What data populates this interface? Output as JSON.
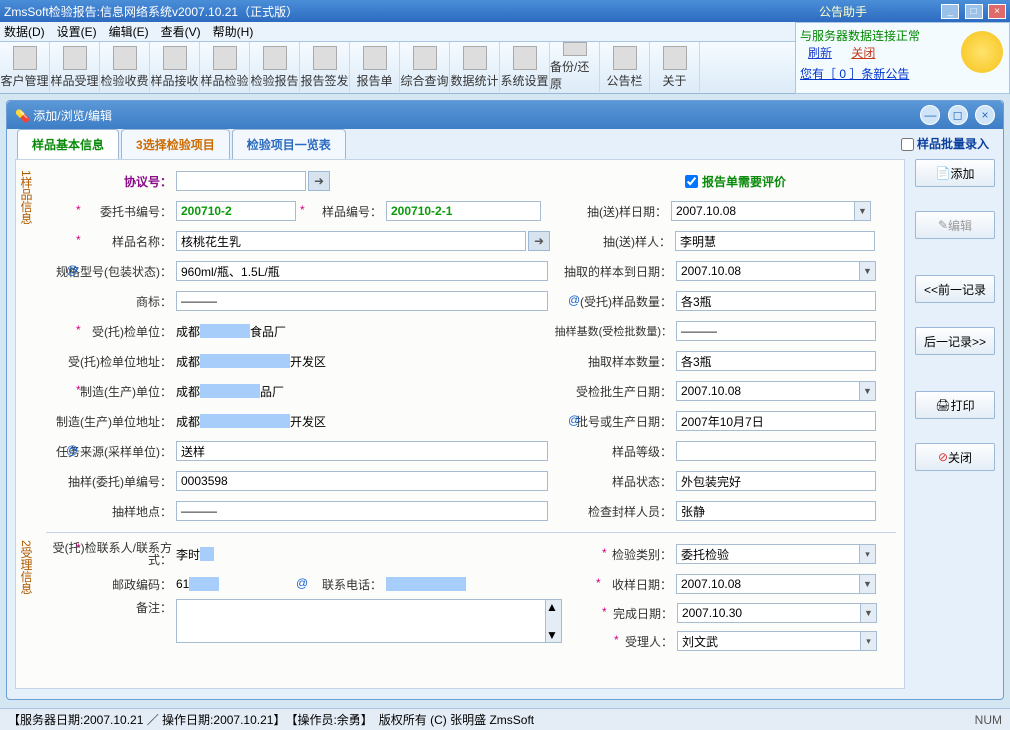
{
  "outer_title": "ZmsSoft检验报告:信息网络系统v2007.10.21（正式版）",
  "assistant": {
    "title": "公告助手",
    "status": "与服务器数据连接正常",
    "refresh": "刷新",
    "close": "关闭",
    "news": "您有［ 0 ］条新公告"
  },
  "menus": [
    "数据(D)",
    "设置(E)",
    "编辑(E)",
    "查看(V)",
    "帮助(H)"
  ],
  "tools": [
    "客户管理",
    "样品受理",
    "检验收费",
    "样品接收",
    "样品检验",
    "检验报告",
    "报告签发",
    "报告单",
    "综合查询",
    "数据统计",
    "系统设置",
    "备份/还原",
    "公告栏",
    "关于"
  ],
  "sub_title": "添加/浏览/编辑",
  "tabs": {
    "t1": "样品基本信息",
    "t2": "3选择检验项目",
    "t3": "检验项目一览表"
  },
  "batch_label": "样品批量录入",
  "group_labels": {
    "g1": "1样品信息",
    "g2": "2受理信息"
  },
  "left": {
    "agreement_lbl": "协议号：",
    "agreement": "",
    "consign_no_lbl": "委托书编号：",
    "consign_no": "200710-2",
    "sample_no_lbl": "样品编号：",
    "sample_no": "200710-2-1",
    "sample_name_lbl": "样品名称：",
    "sample_name": "核桃花生乳",
    "spec_lbl": "规格型号(包装状态)：",
    "spec": "960ml/瓶、1.5L/瓶",
    "trademark_lbl": "商标：",
    "trademark": "———",
    "client_unit_lbl": "受(托)检单位：",
    "client_unit_a": "成都",
    "client_unit_b": "食品厂",
    "client_addr_lbl": "受(托)检单位地址：",
    "client_addr_a": "成都",
    "client_addr_b": "开发区",
    "maker_lbl": "制造(生产)单位：",
    "maker_a": "成都",
    "maker_b": "品厂",
    "maker_addr_lbl": "制造(生产)单位地址：",
    "maker_addr_a": "成都",
    "maker_addr_b": "开发区",
    "task_src_lbl": "任务来源(采样单位)：",
    "task_src": "送样",
    "sampling_no_lbl": "抽样(委托)单编号：",
    "sampling_no": "0003598",
    "sampling_loc_lbl": "抽样地点：",
    "sampling_loc": "———",
    "contact_lbl": "受(托)检联系人/联系方式：",
    "contact": "李时",
    "post_lbl": "邮政编码：",
    "post": "61",
    "phone_lbl": "联系电话：",
    "phone": "",
    "memo_lbl": "备注：",
    "memo": ""
  },
  "right": {
    "eval_label": "报告单需要评价",
    "send_date_lbl": "抽(送)样日期：",
    "send_date": "2007.10.08",
    "sender_lbl": "抽(送)样人：",
    "sender": "李明慧",
    "arrive_date_lbl": "抽取的样本到日期：",
    "arrive_date": "2007.10.08",
    "consign_qty_lbl": "(受托)样品数量：",
    "consign_qty": "各3瓶",
    "base_qty_lbl": "抽样基数(受检批数量)：",
    "base_qty": "———",
    "take_qty_lbl": "抽取样本数量：",
    "take_qty": "各3瓶",
    "batch_date_lbl": "受检批生产日期：",
    "batch_date": "2007.10.08",
    "lot_lbl": "批号或生产日期：",
    "lot": "2007年10月7日",
    "grade_lbl": "样品等级：",
    "grade": "",
    "state_lbl": "样品状态：",
    "state": "外包装完好",
    "seal_lbl": "检查封样人员：",
    "seal": "张静",
    "type_lbl": "检验类别：",
    "type": "委托检验",
    "recv_date_lbl": "收样日期：",
    "recv_date": "2007.10.08",
    "done_date_lbl": "完成日期：",
    "done_date": "2007.10.30",
    "handler_lbl": "受理人：",
    "handler": "刘文武"
  },
  "rbuttons": {
    "add": "添加",
    "edit": "编辑",
    "prev": "<<前一记录",
    "next": "后一记录>>",
    "print": "打印",
    "close": "关闭"
  },
  "status": {
    "left": "【服务器日期:2007.10.21 ／ 操作日期:2007.10.21】　【操作员:余勇】　版权所有 (C) 张明盛 ZmsSoft",
    "num": "NUM"
  }
}
